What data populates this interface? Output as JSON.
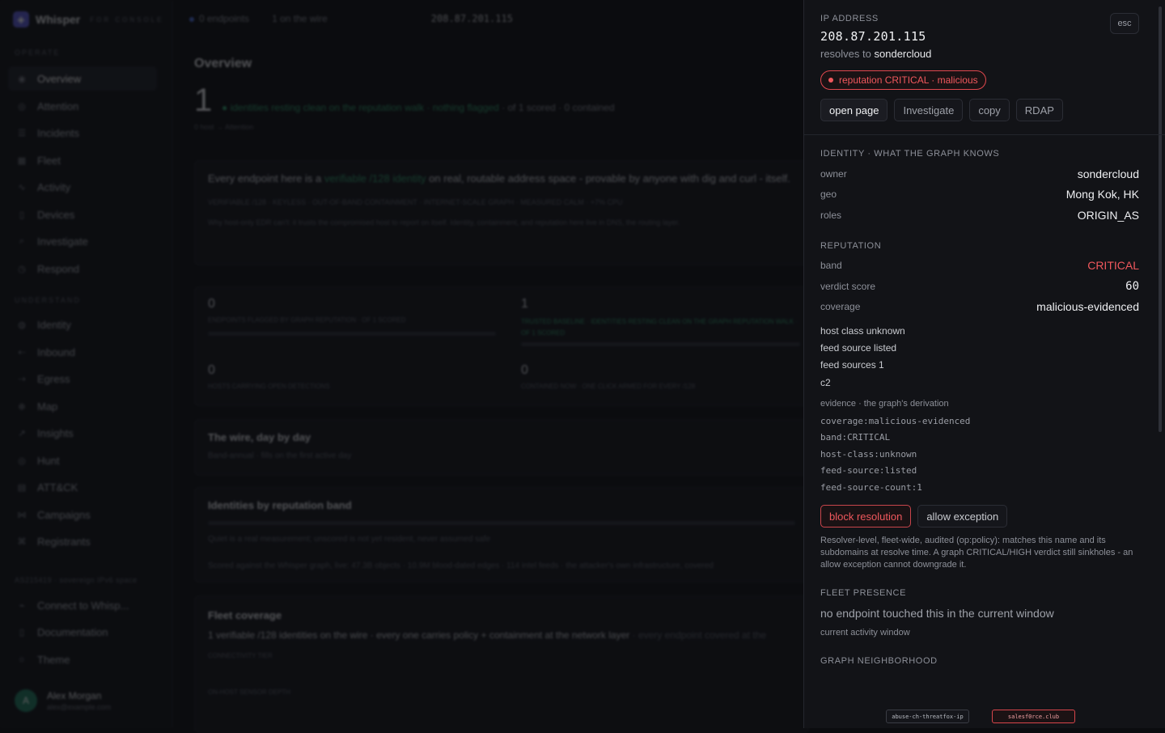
{
  "app": {
    "brand": "Whisper",
    "brand_sub": "FOR CONSOLE",
    "topbar": {
      "endpoints": "0 endpoints",
      "wire": "1 on the wire",
      "ip": "208.87.201.115"
    },
    "nav": {
      "operate_label": "OPERATE",
      "operate": [
        "Overview",
        "Attention",
        "Incidents",
        "Fleet",
        "Activity",
        "Devices",
        "Investigate",
        "Respond"
      ],
      "understand_label": "UNDERSTAND",
      "understand": [
        "Identity",
        "Inbound",
        "Egress",
        "Map",
        "Insights",
        "Hunt",
        "ATT&CK",
        "Campaigns",
        "Registrants"
      ],
      "space_label": "AS215419 · sovereign IPv6 space",
      "footer": [
        "Connect to Whisp...",
        "Documentation",
        "Theme"
      ]
    },
    "user": {
      "initial": "A",
      "name": "Alex Morgan",
      "email": "alex@example.com"
    },
    "overview": {
      "title": "Overview",
      "count": "1",
      "line_green": "identities resting clean on the reputation walk · nothing flagged",
      "line_grey": "· of 1 scored · 0 contained",
      "sub": "0 host → Attention",
      "intro_a": "Every endpoint here is a ",
      "intro_hl": "verifiable /128 identity",
      "intro_b": " on real, routable address space - provable by anyone with dig and curl - itself.",
      "tags": "VERIFIABLE /128 · KEYLESS · OUT-OF-BAND CONTAINMENT · INTERNET-SCALE GRAPH · MEASURED CALM · +7% CPU",
      "para": "Why host-only EDR can't: it trusts the compromised host to report on itself. Identity, containment, and reputation here live in DNS, the routing layer.",
      "stats": [
        {
          "n": "0",
          "l": "ENDPOINTS FLAGGED BY GRAPH REPUTATION · OF 1 SCORED"
        },
        {
          "n": "1",
          "l": "TRUSTED BASELINE · IDENTITIES RESTING CLEAN ON THE GRAPH REPUTATION WALK · OF 1 SCORED"
        },
        {
          "n": "0",
          "l": "HOSTS CARRYING OPEN DETECTIONS"
        },
        {
          "n": "0",
          "l": "CONTAINED NOW · ONE CLICK ARMED FOR EVERY /128"
        }
      ],
      "wire_title": "The wire, day by day",
      "wire_meta": "Band-annual · fills on the first active day",
      "rep_title": "Identities by reputation band",
      "rep_meta": "Quiet is a real measurement; unscored is not yet resident, never assumed safe",
      "rep_foot": "Scored against the Whisper graph, live: 47.3B objects · 10.9M blood-dated edges · 114 intel feeds · the attacker's own infrastructure, covered",
      "fleet_title": "Fleet coverage",
      "fleet_line": "1 verifiable /128 identities on the wire · every one carries policy + containment at the network layer",
      "fleet_tail": "· every endpoint covered at the",
      "fleet_tier": "CONNECTIVITY TIER",
      "fleet_depth": "ON-HOST SENSOR DEPTH"
    }
  },
  "panel": {
    "esc": "esc",
    "ip_label": "IP ADDRESS",
    "ip": "208.87.201.115",
    "resolves_prefix": "resolves to",
    "resolves_host": "sondercloud",
    "badge": "reputation CRITICAL · malicious",
    "actions": [
      "open page",
      "Investigate",
      "copy",
      "RDAP"
    ],
    "identity_label": "IDENTITY · WHAT THE GRAPH KNOWS",
    "identity": [
      {
        "k": "owner",
        "v": "sondercloud"
      },
      {
        "k": "geo",
        "v": "Mong Kok, HK"
      },
      {
        "k": "roles",
        "v": "ORIGIN_AS"
      }
    ],
    "reputation_label": "REPUTATION",
    "reputation": [
      {
        "k": "band",
        "v": "CRITICAL"
      },
      {
        "k": "verdict score",
        "v": "60"
      },
      {
        "k": "coverage",
        "v": "malicious-evidenced"
      }
    ],
    "facts": [
      "host class unknown",
      "feed source listed",
      "feed sources 1",
      "c2"
    ],
    "evidence_label": "evidence · the graph's derivation",
    "evidence": [
      "coverage:malicious-evidenced",
      "band:CRITICAL",
      "host-class:unknown",
      "feed-source:listed",
      "feed-source-count:1"
    ],
    "block_label": "block resolution",
    "allow_label": "allow exception",
    "policy_text": "Resolver-level, fleet-wide, audited (op:policy): matches this name and its subdomains at resolve time. A graph CRITICAL/HIGH verdict still sinkholes - an allow exception cannot downgrade it.",
    "fleet_label": "FLEET PRESENCE",
    "fleet_note": "no endpoint touched this in the current window",
    "fleet_sub": "current activity window",
    "neighborhood_label": "GRAPH NEIGHBORHOOD",
    "nodes": [
      "abuse-ch-threatfox-ip",
      "salesf0rce.club"
    ]
  }
}
